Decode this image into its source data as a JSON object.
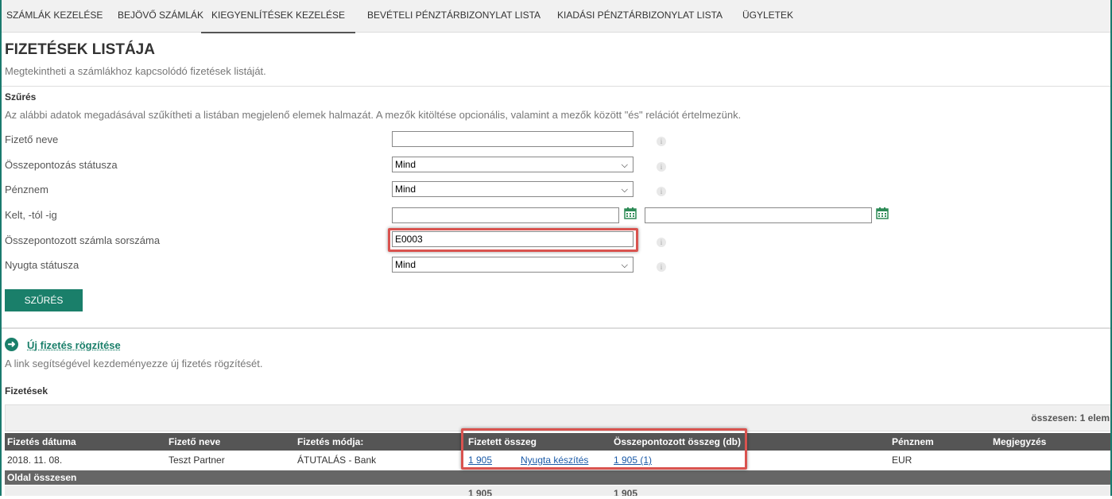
{
  "nav": {
    "tabs": [
      {
        "label": "SZÁMLÁK KEZELÉSE"
      },
      {
        "label": "BEJÖVŐ SZÁMLÁK"
      },
      {
        "label": "KIEGYENLÍTÉSEK KEZELÉSE"
      },
      {
        "label": "BEVÉTELI PÉNZTÁRBIZONYLAT LISTA"
      },
      {
        "label": "KIADÁSI PÉNZTÁRBIZONYLAT LISTA"
      },
      {
        "label": "ÜGYLETEK"
      }
    ],
    "active_tab": "KIEGYENLÍTÉSEK KEZELÉSE"
  },
  "page": {
    "title": "FIZETÉSEK LISTÁJA",
    "subtitle": "Megtekintheti a számlákhoz kapcsolódó fizetések listáját."
  },
  "filter": {
    "title": "Szűrés",
    "description": "Az alábbi adatok megadásával szűkítheti a listában megjelenő elemek halmazát. A mezők kitöltése opcionális, valamint a mezők között \"és\" relációt értelmezünk.",
    "fields": {
      "payer_name_label": "Fizető neve",
      "payer_name_value": "",
      "reconciliation_status_label": "Összepontozás státusza",
      "reconciliation_status_value": "Mind",
      "currency_label": "Pénznem",
      "currency_value": "Mind",
      "date_range_label": "Kelt, -tól -ig",
      "date_from_value": "",
      "date_to_value": "",
      "invoice_number_label": "Összepontozott számla sorszáma",
      "invoice_number_value": "E0003",
      "receipt_status_label": "Nyugta státusza",
      "receipt_status_value": "Mind"
    },
    "submit_label": "SZŰRÉS"
  },
  "new_payment": {
    "link_label": "Új fizetés rögzítése",
    "description": "A link segítségével kezdeményezze új fizetés rögzítését."
  },
  "payments": {
    "title": "Fizetések",
    "total_count": "összesen: 1 elem",
    "columns": [
      "Fizetés dátuma",
      "Fizető neve",
      "Fizetés módja:",
      "Fizetett összeg",
      "Összepontozott összeg (db)",
      "Pénznem",
      "Megjegyzés"
    ],
    "rows": [
      {
        "date": "2018. 11. 08.",
        "payer": "Teszt Partner",
        "method": "ÁTUTALÁS - Bank",
        "paid_amount": "1 905",
        "receipt_action": "Nyugta készítés",
        "reconciled_amount": "1 905 (1)",
        "currency": "EUR",
        "note": ""
      }
    ],
    "page_total_label": "Oldal összesen",
    "page_total_paid": "1 905",
    "page_total_reconciled": "1 905"
  },
  "colors": {
    "accent": "#1a7f6a",
    "highlight": "#d9534f",
    "header": "#555555"
  }
}
